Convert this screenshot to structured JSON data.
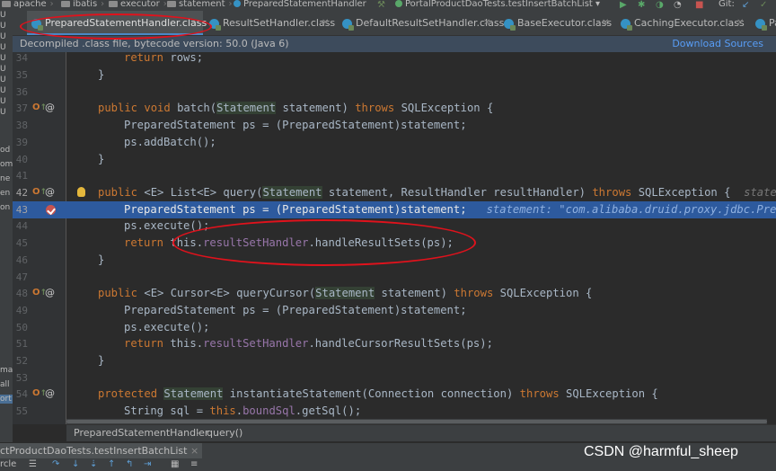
{
  "navbar": {
    "crumbs": [
      "apache",
      "ibatis",
      "executor",
      "statement",
      "PreparedStatementHandler"
    ],
    "run_config": "PortalProductDaoTests.testInsertBatchList",
    "git_label": "Git:"
  },
  "left_strip": {
    "labels": [
      "U",
      "U",
      "U",
      "U",
      "U",
      "U",
      "U",
      "U",
      "U",
      "U",
      "od",
      "om",
      "ne",
      "en",
      "on",
      "",
      "",
      "",
      "",
      "",
      "",
      "",
      "",
      "",
      "ma",
      "all",
      "ort"
    ]
  },
  "tabs": [
    {
      "label": "PreparedStatementHandler.class",
      "active": true
    },
    {
      "label": "ResultSetHandler.class",
      "active": false
    },
    {
      "label": "DefaultResultSetHandler.class",
      "active": false
    },
    {
      "label": "BaseExecutor.class",
      "active": false
    },
    {
      "label": "CachingExecutor.class",
      "active": false
    },
    {
      "label": "Pag",
      "active": false
    }
  ],
  "banner": {
    "text": "Decompiled .class file, bytecode version: 50.0 (Java 6)",
    "link": "Download Sources"
  },
  "code": {
    "l34": {
      "num": "34",
      "kw": "return",
      "rest": " rows;"
    },
    "l35": {
      "num": "35",
      "text": "}"
    },
    "l36": {
      "num": "36"
    },
    "l37": {
      "num": "37",
      "kw1": "public void",
      "name": "batch",
      "type": "Statement",
      "args": " statement) ",
      "kw2": "throws",
      "rest": " SQLException {"
    },
    "l38": {
      "num": "38",
      "text": "PreparedStatement ps = (PreparedStatement)statement;"
    },
    "l39": {
      "num": "39",
      "text": "ps.addBatch();"
    },
    "l40": {
      "num": "40",
      "text": "}"
    },
    "l41": {
      "num": "41"
    },
    "l42": {
      "num": "42",
      "kw1": "public",
      "mid": " <E> List<E> ",
      "name": "query",
      "type": "Statement",
      "args": " statement, ResultHandler resultHandler) ",
      "kw2": "throws",
      "rest": " SQLException {",
      "hint": "state"
    },
    "l43": {
      "num": "43",
      "text": "PreparedStatement ps = (PreparedStatement)statement;",
      "hint": "statement: \"com.alibaba.druid.proxy.jdbc.Prep"
    },
    "l44": {
      "num": "44",
      "text": "ps.execute();"
    },
    "l45": {
      "num": "45",
      "kw": "return",
      "pre": " this.",
      "fld": "resultSetHandler",
      "rest": ".handleResultSets(ps);"
    },
    "l46": {
      "num": "46",
      "text": "}"
    },
    "l47": {
      "num": "47"
    },
    "l48": {
      "num": "48",
      "kw1": "public",
      "mid": " <E> Cursor<E> ",
      "name": "queryCursor",
      "type": "Statement",
      "args": " statement) ",
      "kw2": "throws",
      "rest": " SQLException {"
    },
    "l49": {
      "num": "49",
      "text": "PreparedStatement ps = (PreparedStatement)statement;"
    },
    "l50": {
      "num": "50",
      "text": "ps.execute();"
    },
    "l51": {
      "num": "51",
      "kw": "return",
      "pre": " this.",
      "fld": "resultSetHandler",
      "rest": ".handleCursorResultSets(ps);"
    },
    "l52": {
      "num": "52",
      "text": "}"
    },
    "l53": {
      "num": "53"
    },
    "l54": {
      "num": "54",
      "kw1": "protected",
      "type": "Statement",
      "name": "instantiateStatement",
      "args": "(Connection connection) ",
      "kw2": "throws",
      "rest": " SQLException {"
    },
    "l55": {
      "num": "55",
      "pre": "String sql = ",
      "kw": "this",
      "mid": ".",
      "fld": "boundSql",
      "rest": ".getSql();"
    }
  },
  "breadcrumb": {
    "cls": "PreparedStatementHandler",
    "method": "query()"
  },
  "runbar": {
    "tab": "ctProductDaoTests.testInsertBatchList",
    "close": "×"
  },
  "toolrow": {
    "left": "rcle"
  },
  "watermark": "CSDN @harmful_sheep",
  "colors": {
    "keyword": "#cc7832",
    "field": "#9876aa",
    "current_line": "#2d5a9e",
    "annotation_oval": "#e0121c"
  }
}
